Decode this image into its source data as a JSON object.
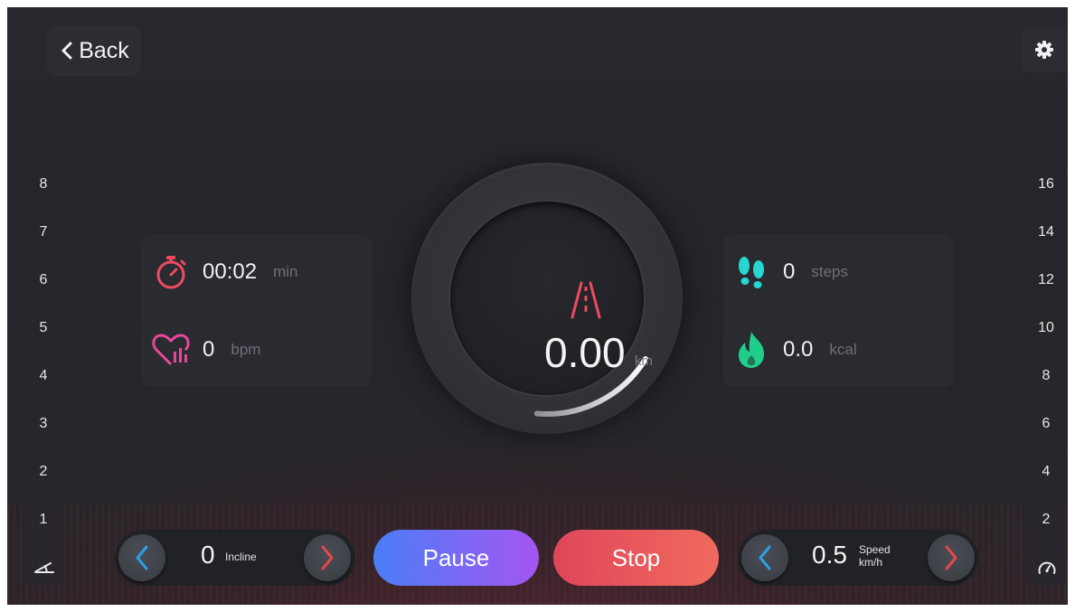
{
  "header": {
    "back_label": "Back",
    "settings_icon": "gear-icon"
  },
  "left_scale": {
    "ticks": [
      "8",
      "7",
      "6",
      "5",
      "4",
      "3",
      "2",
      "1"
    ],
    "icon": "incline-icon"
  },
  "right_scale": {
    "ticks": [
      "16",
      "14",
      "12",
      "10",
      "8",
      "6",
      "4",
      "2"
    ],
    "icon": "speedometer-icon"
  },
  "stats": {
    "time": {
      "value": "00:02",
      "unit": "min",
      "icon": "stopwatch-icon",
      "color": "#ef4b5f"
    },
    "heart": {
      "value": "0",
      "unit": "bpm",
      "icon": "heart-rate-icon",
      "color": "#e9489a"
    },
    "steps": {
      "value": "0",
      "unit": "steps",
      "icon": "footsteps-icon",
      "color": "#27d6d0"
    },
    "calories": {
      "value": "0.0",
      "unit": "kcal",
      "icon": "flame-icon",
      "color": "#1fce8b"
    }
  },
  "distance": {
    "value": "0.00",
    "unit": "km",
    "icon": "road-icon",
    "progress": 0.08
  },
  "incline": {
    "value": "0",
    "label": "Incline"
  },
  "speed": {
    "value": "0.5",
    "label": "Speed",
    "unit": "km/h"
  },
  "buttons": {
    "pause": "Pause",
    "stop": "Stop"
  },
  "colors": {
    "pause_start": "#4a7ef6",
    "pause_end": "#a456f2",
    "stop_start": "#e0465a",
    "stop_end": "#f06a5e",
    "decrease_arrow": "#2f9ee8",
    "increase_arrow": "#e8464f"
  }
}
